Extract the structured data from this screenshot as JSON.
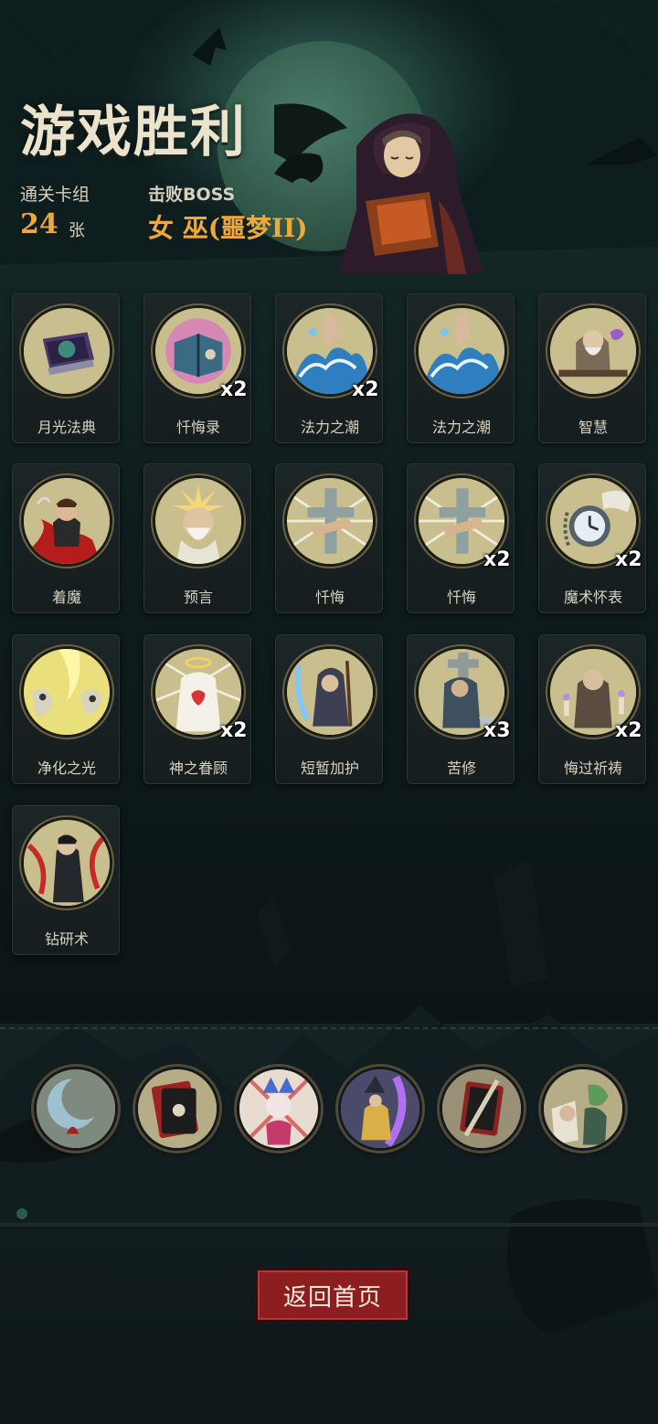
{
  "header": {
    "title": "游戏胜利",
    "deck_label": "通关卡组",
    "deck_count": "24",
    "deck_unit": "张",
    "boss_label": "击败BOSS",
    "boss_name": "女 巫(噩梦II)"
  },
  "cards": [
    {
      "name": "月光法典",
      "qty": "",
      "icon": "moonlight-tome-icon"
    },
    {
      "name": "忏悔录",
      "qty": "x2",
      "icon": "confession-book-icon"
    },
    {
      "name": "法力之潮",
      "qty": "x2",
      "icon": "mana-tide-icon"
    },
    {
      "name": "法力之潮",
      "qty": "",
      "icon": "mana-tide-icon"
    },
    {
      "name": "智慧",
      "qty": "",
      "icon": "wisdom-sage-icon"
    },
    {
      "name": "着魔",
      "qty": "",
      "icon": "possessed-icon"
    },
    {
      "name": "预言",
      "qty": "",
      "icon": "prophecy-icon"
    },
    {
      "name": "忏悔",
      "qty": "",
      "icon": "penitence-cross-icon"
    },
    {
      "name": "忏悔",
      "qty": "x2",
      "icon": "penitence-cross-icon"
    },
    {
      "name": "魔术怀表",
      "qty": "x2",
      "icon": "pocket-watch-icon"
    },
    {
      "name": "净化之光",
      "qty": "",
      "icon": "purifying-light-icon"
    },
    {
      "name": "神之眷顾",
      "qty": "x2",
      "icon": "divine-favor-icon"
    },
    {
      "name": "短暂加护",
      "qty": "",
      "icon": "brief-protection-icon"
    },
    {
      "name": "苦修",
      "qty": "x3",
      "icon": "ascetic-icon"
    },
    {
      "name": "悔过祈祷",
      "qty": "x2",
      "icon": "repentant-prayer-icon"
    },
    {
      "name": "钻研术",
      "qty": "",
      "icon": "study-art-icon"
    }
  ],
  "relics": [
    {
      "icon": "crescent-moon-relic-icon"
    },
    {
      "icon": "cursed-card-relic-icon"
    },
    {
      "icon": "jester-relic-icon"
    },
    {
      "icon": "mage-relic-icon"
    },
    {
      "icon": "torn-card-relic-icon"
    },
    {
      "icon": "zombie-scholar-relic-icon"
    }
  ],
  "buttons": {
    "return_home": "返回首页"
  },
  "colors": {
    "accent_orange": "#f0a83a",
    "button_red": "#8c1e20",
    "background": "#0d1618"
  }
}
